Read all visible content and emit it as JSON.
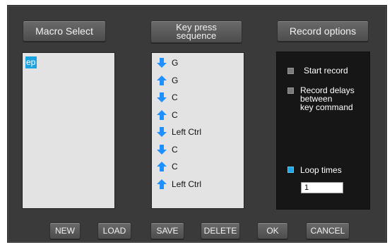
{
  "top_buttons": {
    "macro_select": "Macro Select",
    "key_press_line1": "Key press",
    "key_press_line2": "sequence",
    "record_options": "Record options"
  },
  "macros": [
    {
      "label": "ep",
      "selected": true
    }
  ],
  "key_sequence": [
    {
      "direction": "down",
      "key": "G"
    },
    {
      "direction": "up",
      "key": "G"
    },
    {
      "direction": "down",
      "key": "C"
    },
    {
      "direction": "up",
      "key": "C"
    },
    {
      "direction": "down",
      "key": "Left Ctrl"
    },
    {
      "direction": "down",
      "key": "C"
    },
    {
      "direction": "up",
      "key": "C"
    },
    {
      "direction": "up",
      "key": "Left Ctrl"
    }
  ],
  "record_options": {
    "start_record": {
      "label": "Start record",
      "checked": false
    },
    "record_delays": {
      "line1": "Record delays",
      "line2": "between",
      "line3": "key command",
      "checked": false
    },
    "loop_times": {
      "label": "Loop times",
      "checked": true,
      "value": "1"
    }
  },
  "bottom_buttons": {
    "new": "NEW",
    "load": "LOAD",
    "save": "SAVE",
    "delete": "DELETE",
    "ok": "OK",
    "cancel": "CANCEL"
  },
  "colors": {
    "accent": "#1aa3e0",
    "arrow": "#1e90ff",
    "frame": "#3a3a3a",
    "list_bg": "#e3e3e3",
    "options_bg": "#161616"
  },
  "icons": {
    "down": "arrow-down-icon",
    "up": "arrow-up-icon"
  }
}
